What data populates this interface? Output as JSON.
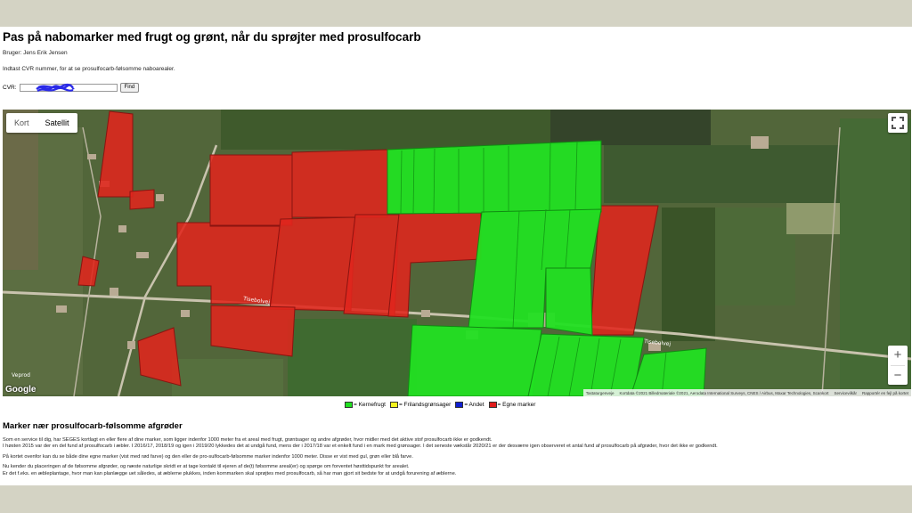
{
  "page": {
    "title": "Pas på nabomarker med frugt og grønt, når du sprøjter med prosulfocarb",
    "user_line": "Bruger: Jens Erik Jensen",
    "instruction": "Indtast CVR nummer, for at se prosulfocarb-følsomme naboarealer.",
    "cvr_label": "CVR:",
    "cvr_value": "",
    "find_label": "Find"
  },
  "map": {
    "type_buttons": [
      "Kort",
      "Satellit"
    ],
    "active_type": "Satellit",
    "zoom_in": "+",
    "zoom_out": "−",
    "google_logo": "Google",
    "attribution": [
      "Tastaturgenveje",
      "Kortdata ©2021 Billedmateriale ©2021, Aerodata International Surveys, CNES / Airbus, Maxar Technologies, Scankort",
      "Servicevilkår",
      "Rapportér en fejl på kortet"
    ],
    "road_labels": [
      "Tisebolvej",
      "Tisebolvej",
      "Veprod"
    ]
  },
  "legend": [
    {
      "label": "= Kernefrugt",
      "color": "#22e022"
    },
    {
      "label": "= Frilandsgrønsager",
      "color": "#f2f21e"
    },
    {
      "label": "= Andet",
      "color": "#1020d0"
    },
    {
      "label": "= Egne marker",
      "color": "#e01c1c"
    }
  ],
  "info": {
    "heading": "Marker nær prosulfocarb-følsomme afgrøder",
    "paragraphs": [
      "Som en service til dig, har SEGES kortlagt en eller flere af dine marker, som ligger indenfor 1000 meter fra et areal med frugt, grøntsager og andre afgrøder, hvor midler med det aktive stof prosulfocarb ikke er godkendt.",
      "I høsten 2015 var der en del fund af prosulfocarb i æbler. I 2016/17, 2018/19 og igen i 2019/20 lykkedes det at undgå fund, mens der i 2017/18 var et enkelt fund i en mark med grønsager. I det seneste vækstår 2020/21 er der desværre igen observeret et antal fund af prosulfocarb på afgrøder, hvor det ikke er godkendt.",
      "På kortet ovenfor kan du se både dine egne marker (vist med rød farve) og den eller de pro-sulfocarb-følsomme marker indenfor 1000 meter. Disse er vist med gul, grøn eller blå farve.",
      "Nu kender du placeringen af de følsomme afgrøder, og næste naturlige skridt er at tage kontakt til ejeren af de(t) følsomme areal(er) og spørge om forventet høsttidspunkt for arealet.",
      "Er det f.eks. en æbleplantage, hvor man kan planlægge uet således, at æblerne plukkes, inden kornmarken skal sprøjtes med prosulfocarb, så har man gjort sit bedste for at undgå forurening af æblerne."
    ]
  }
}
